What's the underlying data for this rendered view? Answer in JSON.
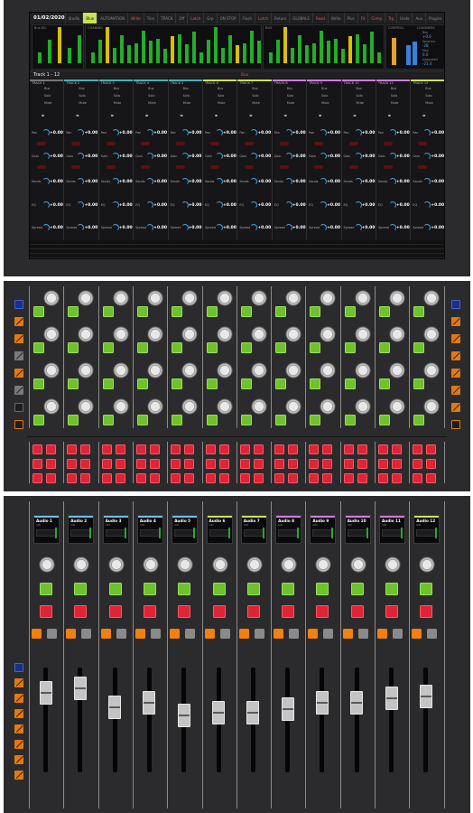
{
  "display": {
    "date": "01/02/2020",
    "top_tabs": [
      {
        "label": "Studio",
        "state": "normal"
      },
      {
        "label": "Blue",
        "state": "selected"
      },
      {
        "label": "AUTOMATION",
        "state": "normal"
      },
      {
        "label": "Write",
        "state": "hot"
      },
      {
        "label": "Trim",
        "state": "normal"
      },
      {
        "label": "TRACK",
        "state": "normal"
      },
      {
        "label": "Off",
        "state": "normal"
      },
      {
        "label": "Latch",
        "state": "hot"
      },
      {
        "label": "Grp",
        "state": "normal"
      },
      {
        "label": "ON STOP",
        "state": "normal"
      },
      {
        "label": "Flash",
        "state": "normal"
      },
      {
        "label": "Latch",
        "state": "hot"
      },
      {
        "label": "Return",
        "state": "normal"
      },
      {
        "label": "GLOBALS",
        "state": "normal"
      },
      {
        "label": "Read",
        "state": "hot"
      },
      {
        "label": "Write",
        "state": "normal"
      },
      {
        "label": "Plus",
        "state": "normal"
      },
      {
        "label": "Fit",
        "state": "hot"
      },
      {
        "label": "Comp",
        "state": "hot"
      },
      {
        "label": "Trg",
        "state": "hot"
      },
      {
        "label": "Undo",
        "state": "normal"
      },
      {
        "label": "Aux",
        "state": "normal"
      },
      {
        "label": "Plugins",
        "state": "normal"
      },
      {
        "label": "Log",
        "state": "normal"
      }
    ],
    "meter_label_left": "Bus M1",
    "meter_label_mid": "CHANNEL",
    "meter_label_right": "BUS",
    "control_label": "CONTROL",
    "loudness_label": "LOUDNESS",
    "right_panel": [
      {
        "label": "Bus",
        "value": "+0.0"
      },
      {
        "label": "Send dur",
        "value": "-28"
      },
      {
        "label": "Mon",
        "value": "0.0"
      },
      {
        "label": "Integrated",
        "value": "-21.4"
      }
    ],
    "track_range": "Track 1 - 12",
    "mark": "Bus",
    "strips": [
      {
        "name": "TRACK 1",
        "color": "#777777"
      },
      {
        "name": "TRACK 2",
        "color": "#4ab0b8"
      },
      {
        "name": "TRACK 3",
        "color": "#4ab0b8"
      },
      {
        "name": "TRACK 4",
        "color": "#4ab0b8"
      },
      {
        "name": "TRACK 5",
        "color": "#4ab0b8"
      },
      {
        "name": "TRACK 6",
        "color": "#c8e35a"
      },
      {
        "name": "TRACK 7",
        "color": "#c8e35a"
      },
      {
        "name": "TRACK 8",
        "color": "#d47adf"
      },
      {
        "name": "TRACK 9",
        "color": "#d47adf"
      },
      {
        "name": "TRACK 10",
        "color": "#d47adf"
      },
      {
        "name": "TRACK 11",
        "color": "#d47adf"
      },
      {
        "name": "TRACK 12",
        "color": "#c8e35a"
      }
    ],
    "strip_rows": {
      "row1": [
        "Bus",
        "Solo",
        "Mute"
      ],
      "pan_label": "Pan",
      "pan_value": "+0.00",
      "gain_label": "Gain",
      "gain_value": "+0.00",
      "sends_label": "Sends",
      "sends_value": "+0.00",
      "eq_label": "EQ",
      "eq_value": "+0.00",
      "spread_label": "Spread",
      "spread_value": "+0.00"
    },
    "strip_values": [
      [
        "+0.00",
        "+0.00",
        "+0.00",
        "+0.00",
        "+0.00"
      ],
      [
        "+0.00",
        "+0.00",
        "+0.00",
        "+0.00",
        "+0.00"
      ],
      [
        "+0.00",
        "+0.00",
        "+0.00",
        "+0.00",
        "+0.00"
      ],
      [
        "+0.00",
        "+0.00",
        "+0.00",
        "+0.00",
        "+0.00"
      ],
      [
        "+0.00",
        "+0.00",
        "+0.00",
        "+0.00",
        "+0.00"
      ],
      [
        "+0.00",
        "+0.00",
        "+0.00",
        "+0.00",
        "+0.00"
      ],
      [
        "+0.00",
        "+0.00",
        "+0.00",
        "+0.00",
        "+0.00"
      ],
      [
        "+0.00",
        "+0.00",
        "+0.00",
        "+0.00",
        "+0.00"
      ],
      [
        "+0.00",
        "+0.00",
        "+0.00",
        "+0.00",
        "+0.00"
      ],
      [
        "+0.00",
        "+0.00",
        "+0.00",
        "+0.00",
        "+0.00"
      ],
      [
        "+0.00",
        "+0.00",
        "+0.00",
        "+0.00",
        "+0.00"
      ],
      [
        "+0.00",
        "+0.00",
        "+0.00",
        "+0.00",
        "+0.00"
      ]
    ]
  },
  "pad_module": {
    "left_buttons": [
      "blue",
      "orange",
      "orange",
      "gray",
      "orange",
      "gray",
      "outline",
      "outline-orange"
    ],
    "right_buttons": [
      "blue",
      "orange",
      "orange",
      "orange",
      "orange",
      "orange",
      "orange",
      "outline-orange"
    ],
    "channels": 12,
    "knob_rows": 4,
    "pad_rows": 3
  },
  "fader_module": {
    "channels": [
      {
        "name": "Audio 1",
        "color": "#6ec0e8",
        "fader_level": 0.72
      },
      {
        "name": "Audio 2",
        "color": "#6ec0e8",
        "fader_level": 0.78
      },
      {
        "name": "Audio 3",
        "color": "#6ec0e8",
        "fader_level": 0.55
      },
      {
        "name": "Audio 4",
        "color": "#6ec0e8",
        "fader_level": 0.6
      },
      {
        "name": "Audio 5",
        "color": "#6ec0e8",
        "fader_level": 0.45
      },
      {
        "name": "Audio 6",
        "color": "#c8e35a",
        "fader_level": 0.48
      },
      {
        "name": "Audio 7",
        "color": "#c8e35a",
        "fader_level": 0.48
      },
      {
        "name": "Audio 8",
        "color": "#d47adf",
        "fader_level": 0.52
      },
      {
        "name": "Audio 9",
        "color": "#d47adf",
        "fader_level": 0.6
      },
      {
        "name": "Audio 10",
        "color": "#d47adf",
        "fader_level": 0.6
      },
      {
        "name": "Audio 11",
        "color": "#d47adf",
        "fader_level": 0.66
      },
      {
        "name": "Audio 12",
        "color": "#c8e35a",
        "fader_level": 0.68
      }
    ],
    "channel_sub": "mtr",
    "left_buttons": [
      "blue",
      "orange",
      "orange",
      "orange",
      "orange",
      "orange",
      "orange",
      "orange"
    ]
  }
}
